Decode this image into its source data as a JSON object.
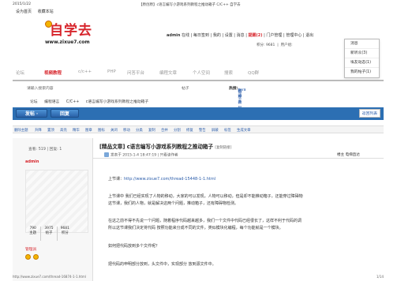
{
  "print": {
    "date": "2015/1/22",
    "title": "【原创原】c语言编写小游戏系列教程之推动箱子 C/C++ 自学去",
    "url": "http://www.zixue7.com/thread-16874-1-1.html",
    "page": "1/14"
  },
  "toplinks": [
    "设为首页",
    "收藏本站"
  ],
  "logo": {
    "title": "自学去",
    "url": "www.zixue7.com"
  },
  "userbar": {
    "username": "admin",
    "items": [
      "在线",
      "每日签到",
      "我的",
      "设置",
      "消息",
      "提醒(2)",
      "门户管理",
      "管理中心",
      "退出"
    ]
  },
  "credits": {
    "label": "积分: 9681",
    "group": "用户组:"
  },
  "dropdown": [
    "消息",
    "新听众(3)",
    "埃友动态(1)",
    "我的帖子(1)"
  ],
  "nav": {
    "items": [
      "论坛",
      "视频教程",
      "c/c++",
      "PHP",
      "问答平台",
      "编程文章",
      "个人空间",
      "搜索",
      "QQ群"
    ],
    "active": "视频教程"
  },
  "subnav": {
    "search_placeholder": "请输入搜索内容",
    "type": "帖子",
    "hot_label": "热搜:",
    "hot_items": [
      "c语言",
      "java",
      "编程教程",
      "自学去"
    ]
  },
  "breadcrumb": [
    "论坛",
    "编程语言",
    "C/C++",
    "c语言编写小游戏系列教程之推动箱子"
  ],
  "actions": {
    "post": "发帖 ·",
    "reply": "回复",
    "back": "返回列表"
  },
  "modbar": [
    "删除主题",
    "升降",
    "置顶",
    "高亮",
    "精华",
    "图章",
    "图标",
    "关闭",
    "移动",
    "分类",
    "复制",
    "合并",
    "分割",
    "修复",
    "警告",
    "屏蔽",
    "标签",
    "生成文章"
  ],
  "sidebar": {
    "views_replies": "查看: 519 | 回复: 1",
    "author": "admin",
    "stats": [
      {
        "value": "790",
        "label": "主题"
      },
      {
        "value": "3975",
        "label": "帖子"
      },
      {
        "value": "9681",
        "label": "积分"
      }
    ],
    "role": "管理员"
  },
  "post": {
    "tag": "[精品文章]",
    "title": " c语言编写小游戏系列教程之推动箱子",
    "copy_link": "[复制链接]",
    "posted": "发表于 2015-1-4 18:47:19 | 只看该作者",
    "floor": "楼主  电梯直达",
    "prev_label": "上节课：",
    "prev_url": "http://www.zixue7.com/thread-15448-1-1.html",
    "para1_line1": "上节课中 我们已经实现了人物的移动，大家的可以发现，人物可以移动，但是却不能推动箱子，还能穿过障碍物",
    "para1_line2": "这节课，我们的人物，就是解决这两个问题，推动箱子，还有障碍物检测。",
    "para2_line1": "在这之前不得不先说一个问题，随着程序代码越来越多，我们一个文件中代码已经很长了，这样不利于代码的调",
    "para2_line2": "所以这节课我们决定将代码 按照功能来分成不同的文件，类似模块化编程，每个功能就是一个模块。",
    "q1": "如何把代码放到多个文件呢？",
    "q2": "把代码的申明部分放到，头文件中，实现部分 放到源文件中。"
  },
  "colors": {
    "accent": "#d7262d",
    "blue": "#2c6fb3"
  }
}
